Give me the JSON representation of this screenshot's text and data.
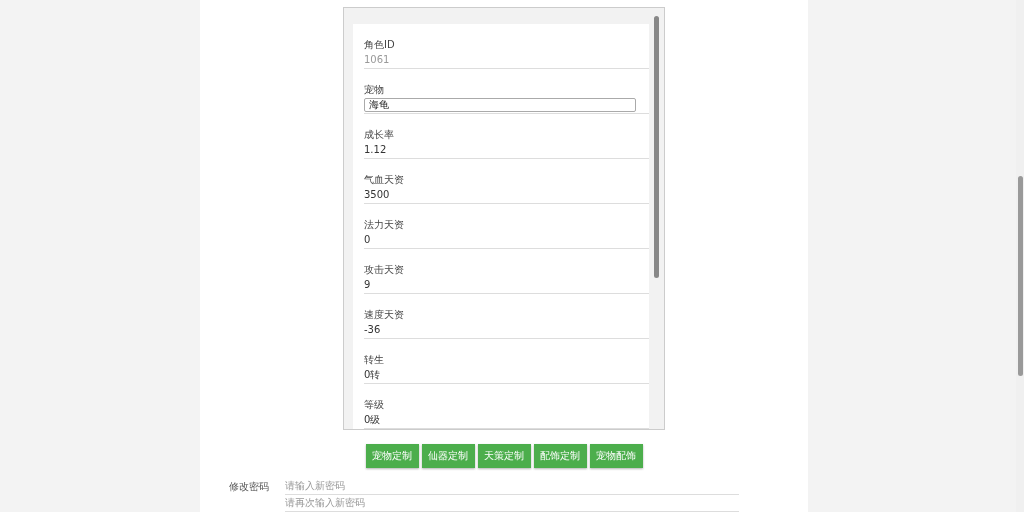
{
  "pet_form": {
    "fields": [
      {
        "kind": "readonly",
        "label": "角色ID",
        "value": "1061"
      },
      {
        "kind": "select",
        "label": "宠物",
        "value": "海龟"
      },
      {
        "kind": "input",
        "label": "成长率",
        "value": "1.12"
      },
      {
        "kind": "input",
        "label": "气血天资",
        "value": "3500"
      },
      {
        "kind": "input",
        "label": "法力天资",
        "value": "0"
      },
      {
        "kind": "input",
        "label": "攻击天资",
        "value": "9"
      },
      {
        "kind": "input",
        "label": "速度天资",
        "value": "-36"
      },
      {
        "kind": "input",
        "label": "转生",
        "value": "0转"
      },
      {
        "kind": "input",
        "label": "等级",
        "value": "0级"
      }
    ]
  },
  "actions": [
    "宠物定制",
    "仙器定制",
    "天策定制",
    "配饰定制",
    "宠物配饰"
  ],
  "password": {
    "label": "修改密码",
    "fields": [
      {
        "placeholder": "请输入新密码"
      },
      {
        "placeholder": "请再次输入新密码"
      }
    ]
  }
}
